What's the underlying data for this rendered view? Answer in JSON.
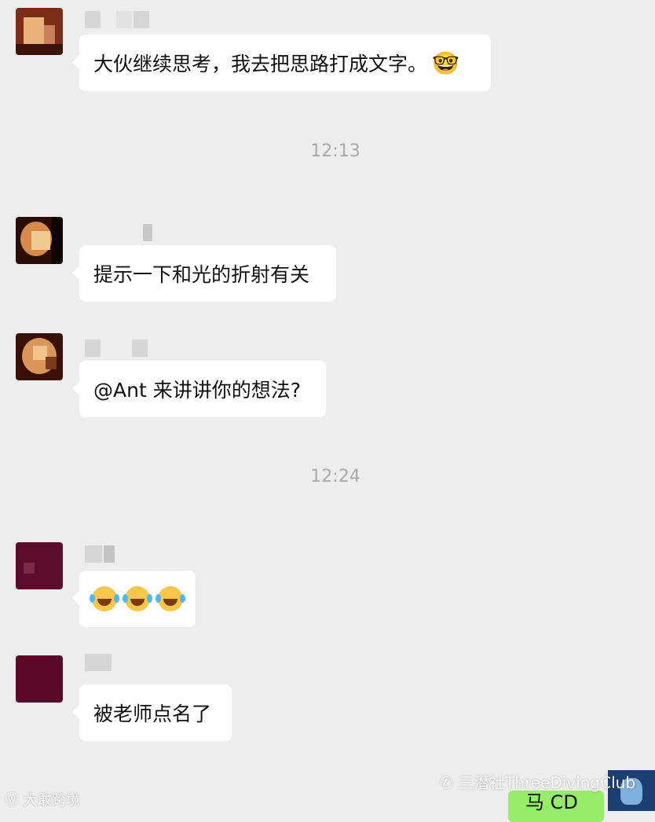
{
  "messages": [
    {
      "type": "text",
      "text": "大伙继续思考，我去把思路打成文字。",
      "emoji": "smiling-face-with-glasses"
    },
    {
      "type": "time",
      "text": "12:13"
    },
    {
      "type": "text",
      "text": "提示一下和光的折射有关"
    },
    {
      "type": "text",
      "text": "@Ant 来讲讲你的想法?"
    },
    {
      "type": "time",
      "text": "12:24"
    },
    {
      "type": "emoji",
      "emoji": "face-with-tears-of-joy",
      "count": 3
    },
    {
      "type": "text",
      "text": "被老师点名了"
    }
  ],
  "own_message": {
    "text": "马 CD"
  },
  "watermarks": {
    "left": "大敢跨境",
    "right": "三潜社ThreeDivingClub"
  },
  "colors": {
    "background": "#ededed",
    "bubble_in": "#ffffff",
    "bubble_out": "#95ec69",
    "timestamp": "#a9a9a9"
  }
}
